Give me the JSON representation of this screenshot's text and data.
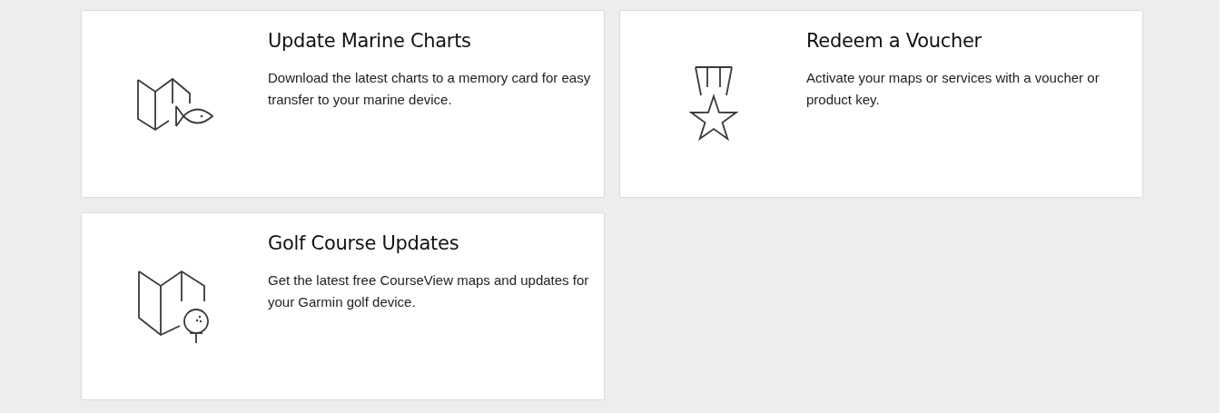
{
  "cards": [
    {
      "kind": "marine",
      "title": "Update Marine Charts",
      "description": "Download the latest charts to a memory card for easy transfer to your marine device."
    },
    {
      "kind": "voucher",
      "title": "Redeem a Voucher",
      "description": "Activate your maps or services with a voucher or product key."
    },
    {
      "kind": "golf",
      "title": "Golf Course Updates",
      "description": "Get the latest free CourseView maps and updates for your Garmin golf device."
    }
  ]
}
